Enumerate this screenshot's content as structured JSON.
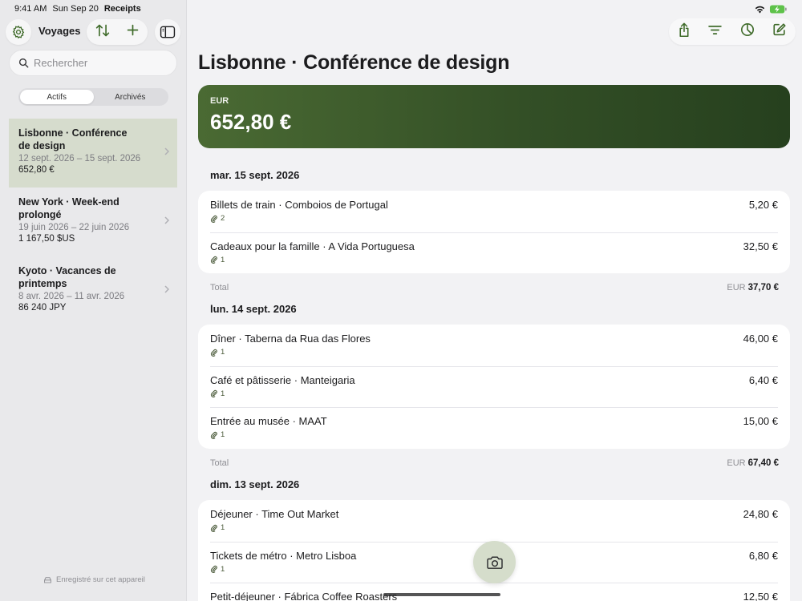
{
  "status": {
    "time": "9:41 AM",
    "date": "Sun Sep 20",
    "app": "Receipts"
  },
  "sidebar": {
    "title": "Voyages",
    "search_placeholder": "Rechercher",
    "segments": [
      "Actifs",
      "Archivés"
    ],
    "trips": [
      {
        "name": "Lisbonne · Conférence de design",
        "dates": "12 sept. 2026 – 15 sept. 2026",
        "amount": "652,80 €",
        "selected": true
      },
      {
        "name": "New York · Week-end prolongé",
        "dates": "19 juin 2026 – 22 juin 2026",
        "amount": "1 167,50 $US",
        "selected": false
      },
      {
        "name": "Kyoto · Vacances de printemps",
        "dates": "8 avr. 2026 – 11 avr. 2026",
        "amount": "86 240 JPY",
        "selected": false
      }
    ],
    "footer": "Enregistré sur cet appareil"
  },
  "main": {
    "title": "Lisbonne · Conférence de design",
    "summary": {
      "currency": "EUR",
      "total": "652,80 €"
    },
    "total_label": "Total",
    "days": [
      {
        "date": "mar. 15 sept. 2026",
        "items": [
          {
            "name": "Billets de train · Comboios de Portugal",
            "amount": "5,20 €",
            "attachments": "2"
          },
          {
            "name": "Cadeaux pour la famille · A Vida Portuguesa",
            "amount": "32,50 €",
            "attachments": "1"
          }
        ],
        "total_currency": "EUR",
        "total": "37,70 €"
      },
      {
        "date": "lun. 14 sept. 2026",
        "items": [
          {
            "name": "Dîner · Taberna da Rua das Flores",
            "amount": "46,00 €",
            "attachments": "1"
          },
          {
            "name": "Café et pâtisserie · Manteigaria",
            "amount": "6,40 €",
            "attachments": "1"
          },
          {
            "name": "Entrée au musée · MAAT",
            "amount": "15,00 €",
            "attachments": "1"
          }
        ],
        "total_currency": "EUR",
        "total": "67,40 €"
      },
      {
        "date": "dim. 13 sept. 2026",
        "items": [
          {
            "name": "Déjeuner · Time Out Market",
            "amount": "24,80 €",
            "attachments": "1"
          },
          {
            "name": "Tickets de métro · Metro Lisboa",
            "amount": "6,80 €",
            "attachments": "1"
          },
          {
            "name": "Petit-déjeuner · Fábrica Coffee Roasters",
            "amount": "12,50 €",
            "attachments": ""
          }
        ]
      }
    ]
  },
  "colors": {
    "accent": "#3f6b2a",
    "card_dark": "#2a451f",
    "selection": "#d6dccd"
  }
}
